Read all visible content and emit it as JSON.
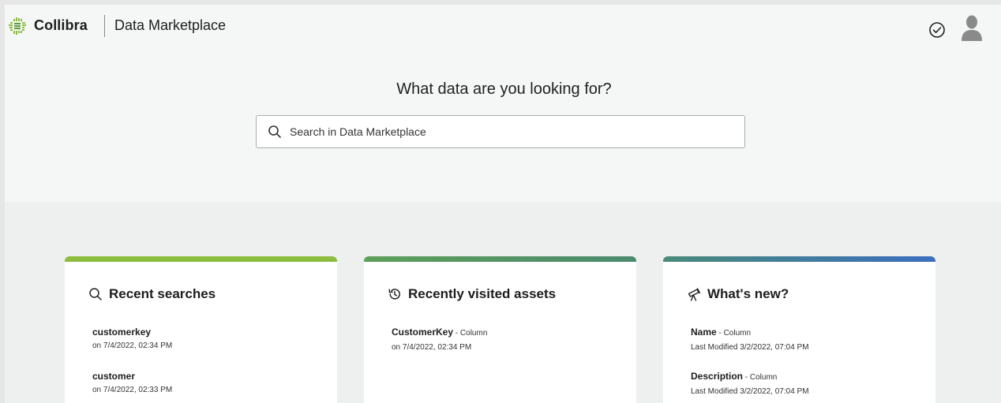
{
  "header": {
    "brand": "Collibra",
    "app_name": "Data Marketplace",
    "icons": {
      "logo": "collibra-logo-icon",
      "tasks": "check-circle-icon",
      "avatar": "user-avatar-icon"
    }
  },
  "hero": {
    "title": "What data are you looking for?",
    "search": {
      "placeholder": "Search in Data Marketplace",
      "value": ""
    }
  },
  "colors": {
    "recent_bar": "#8dbd3f",
    "visited_bar_from": "#5e9f59",
    "visited_bar_to": "#4b8a6e",
    "new_bar_from": "#4a8a7a",
    "new_bar_to": "#3a6fbf"
  },
  "cards": {
    "recent_searches": {
      "title": "Recent searches",
      "icon": "search-icon",
      "items": [
        {
          "name": "customerkey",
          "sub": "on 7/4/2022, 02:34 PM"
        },
        {
          "name": "customer",
          "sub": "on 7/4/2022, 02:33 PM"
        }
      ]
    },
    "recently_visited": {
      "title": "Recently visited assets",
      "icon": "history-icon",
      "items": [
        {
          "name": "CustomerKey",
          "type": " - Column",
          "sub": "on 7/4/2022, 02:34 PM"
        }
      ]
    },
    "whats_new": {
      "title": "What's new?",
      "icon": "telescope-icon",
      "items": [
        {
          "name": "Name",
          "type": " - Column",
          "sub": "Last Modified 3/2/2022, 07:04 PM"
        },
        {
          "name": "Description",
          "type": " - Column",
          "sub": "Last Modified 3/2/2022, 07:04 PM"
        }
      ]
    }
  }
}
